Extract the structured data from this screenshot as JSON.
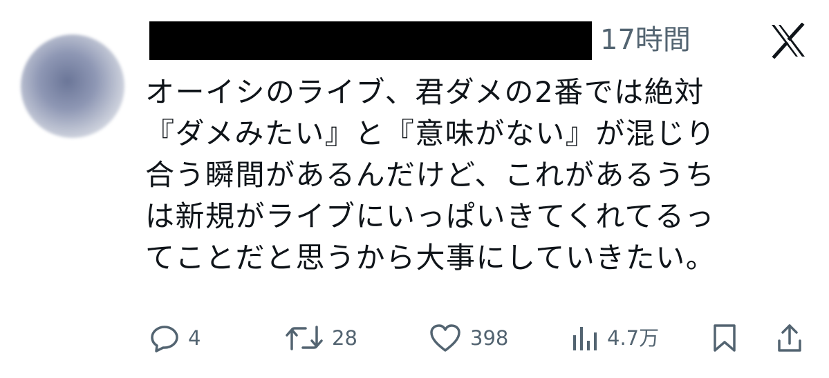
{
  "tweet": {
    "timestamp": "17時間",
    "text_lines": [
      "オーイシのライブ、君ダメの2番では絶対",
      "『ダメみたい』と『意味がない』が混じり",
      "合う瞬間があるんだけど、これがあるうち",
      "は新規がライブにいっぱいきてくれてるっ",
      "てことだと思うから大事にしていきたい。"
    ]
  },
  "actions": {
    "replies": "4",
    "reposts": "28",
    "likes": "398",
    "views": "4.7万"
  },
  "icons": {
    "brand": "x-logo-icon",
    "reply": "reply-icon",
    "repost": "repost-icon",
    "like": "heart-icon",
    "views": "analytics-icon",
    "bookmark": "bookmark-icon",
    "share": "share-icon"
  },
  "colors": {
    "text": "#0f1419",
    "secondary": "#536471",
    "redaction": "#000000"
  }
}
